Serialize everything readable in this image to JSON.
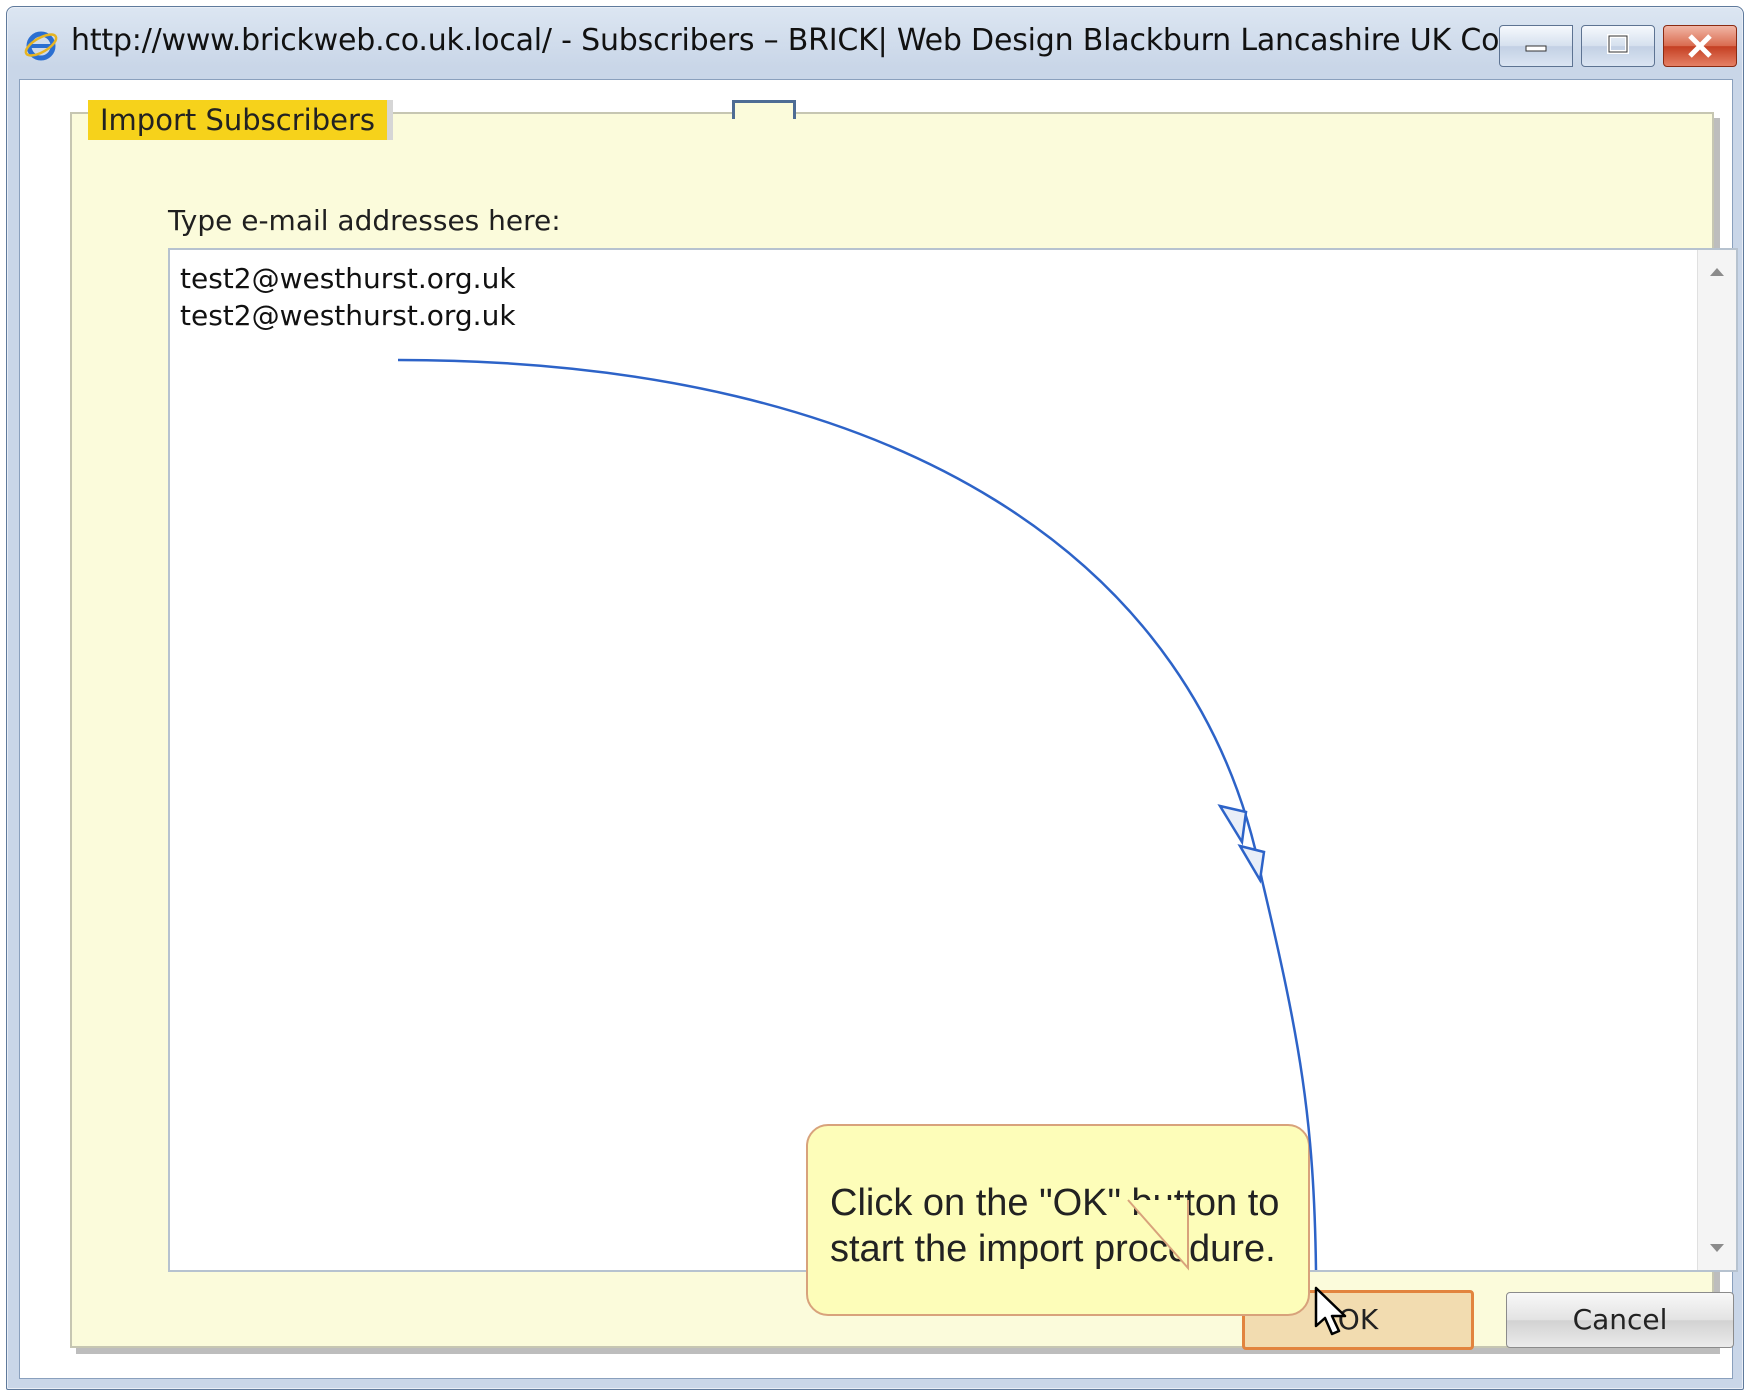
{
  "window": {
    "title": "http://www.brickweb.co.uk.local/ - Subscribers – BRICK| Web Design Blackburn Lancashire UK Con...",
    "browser_icon": "internet-explorer-icon",
    "controls": [
      "minimize-icon",
      "maximize-icon",
      "close-icon"
    ]
  },
  "dialog": {
    "legend": "Import Subscribers",
    "prompt": "Type e-mail addresses here:",
    "emails": [
      "test2@westhurst.org.uk",
      "test2@westhurst.org.uk"
    ],
    "ok_label": "OK",
    "cancel_label": "Cancel"
  },
  "callout": {
    "text_line1": "Click on the \"OK\" button to",
    "text_line2": "start the import procedure."
  },
  "colors": {
    "legend_bg": "#f6d21b",
    "panel_bg": "#fbfbdb",
    "callout_bg": "#fdfdb9",
    "arrow": "#2d63c8",
    "ok_border": "#e2843e"
  }
}
